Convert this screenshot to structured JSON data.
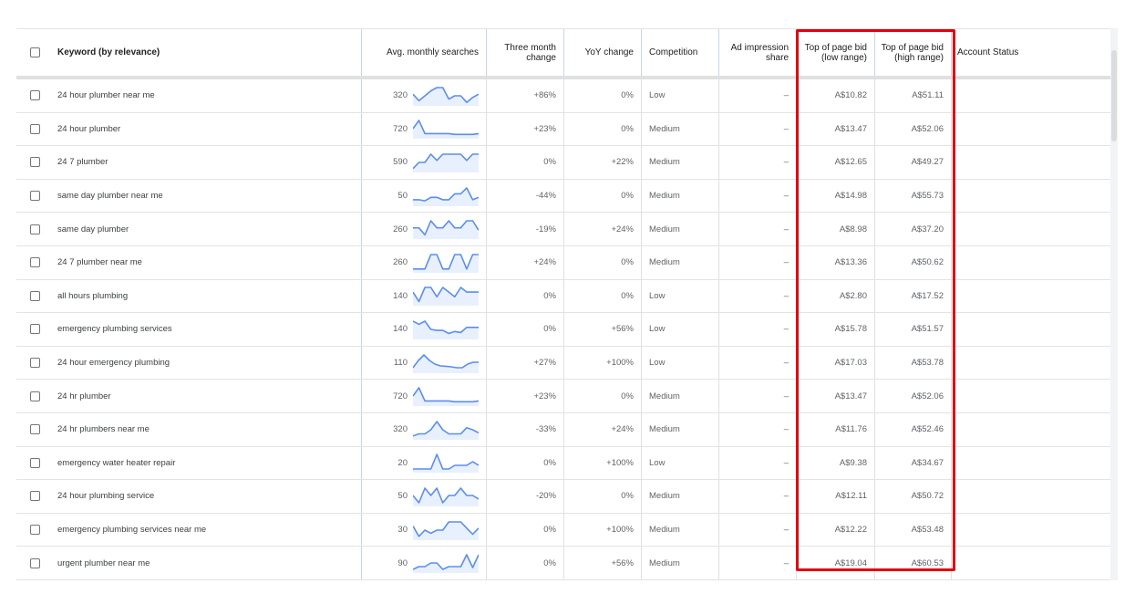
{
  "table": {
    "headers": {
      "keyword": "Keyword (by relevance)",
      "avg_searches": "Avg. monthly searches",
      "three_month": "Three month change",
      "yoy": "YoY change",
      "competition": "Competition",
      "ad_impression": "Ad impression share",
      "bid_low": "Top of page bid (low range)",
      "bid_high": "Top of page bid (high range)",
      "account_status": "Account Status"
    },
    "icons": {
      "select_all": "checkbox-icon",
      "row_select": "checkbox-icon",
      "trend": "sparkline-chart"
    },
    "colors": {
      "highlight_box": "#e3000f",
      "sparkline": "#5b8def",
      "sparkline_fill": "#e8f0fe"
    },
    "rows": [
      {
        "keyword": "24 hour plumber near me",
        "avg": "320",
        "trend": [
          6,
          2,
          5,
          8,
          10,
          10,
          3,
          5,
          5,
          1,
          4,
          6
        ],
        "three_month": "+86%",
        "yoy": "0%",
        "competition": "Low",
        "ad_share": "–",
        "bid_low": "A$10.82",
        "bid_high": "A$51.11"
      },
      {
        "keyword": "24 hour plumber",
        "avg": "720",
        "trend": [
          5,
          10,
          2,
          2,
          2,
          2,
          2,
          1.5,
          1.5,
          1.5,
          1.5,
          2
        ],
        "three_month": "+23%",
        "yoy": "0%",
        "competition": "Medium",
        "ad_share": "–",
        "bid_low": "A$13.47",
        "bid_high": "A$52.06"
      },
      {
        "keyword": "24 7 plumber",
        "avg": "590",
        "trend": [
          1,
          4,
          4,
          8,
          5,
          8,
          8,
          8,
          8,
          5,
          8,
          8
        ],
        "three_month": "0%",
        "yoy": "+22%",
        "competition": "Medium",
        "ad_share": "–",
        "bid_low": "A$12.65",
        "bid_high": "A$49.27"
      },
      {
        "keyword": "same day plumber near me",
        "avg": "50",
        "trend": [
          2,
          2,
          1.5,
          3,
          3,
          2,
          2,
          4.5,
          4.5,
          7,
          2,
          3
        ],
        "three_month": "-44%",
        "yoy": "0%",
        "competition": "Medium",
        "ad_share": "–",
        "bid_low": "A$14.98",
        "bid_high": "A$55.73"
      },
      {
        "keyword": "same day plumber",
        "avg": "260",
        "trend": [
          4,
          4,
          1,
          7,
          4,
          4,
          7,
          4,
          4,
          7,
          7,
          3
        ],
        "three_month": "-19%",
        "yoy": "+24%",
        "competition": "Medium",
        "ad_share": "–",
        "bid_low": "A$8.98",
        "bid_high": "A$37.20"
      },
      {
        "keyword": "24 7 plumber near me",
        "avg": "260",
        "trend": [
          1,
          1,
          1,
          8,
          8,
          1,
          1,
          8,
          8,
          1,
          8,
          8
        ],
        "three_month": "+24%",
        "yoy": "0%",
        "competition": "Medium",
        "ad_share": "–",
        "bid_low": "A$13.36",
        "bid_high": "A$50.62"
      },
      {
        "keyword": "all hours plumbing",
        "avg": "140",
        "trend": [
          5,
          1,
          7,
          7,
          3,
          7,
          5,
          3,
          7,
          5,
          5,
          5
        ],
        "three_month": "0%",
        "yoy": "0%",
        "competition": "Low",
        "ad_share": "–",
        "bid_low": "A$2.80",
        "bid_high": "A$17.52"
      },
      {
        "keyword": "emergency plumbing services",
        "avg": "140",
        "trend": [
          8,
          6.5,
          8,
          4,
          3.5,
          3.5,
          2,
          3,
          2.5,
          5,
          5,
          5
        ],
        "three_month": "0%",
        "yoy": "+56%",
        "competition": "Low",
        "ad_share": "–",
        "bid_low": "A$15.78",
        "bid_high": "A$51.57"
      },
      {
        "keyword": "24 hour emergency plumbing",
        "avg": "110",
        "trend": [
          2,
          6,
          9,
          6,
          4,
          3,
          2.8,
          2.5,
          2,
          2,
          4,
          5,
          5
        ],
        "three_month": "+27%",
        "yoy": "+100%",
        "competition": "Low",
        "ad_share": "–",
        "bid_low": "A$17.03",
        "bid_high": "A$53.78"
      },
      {
        "keyword": "24 hr plumber",
        "avg": "720",
        "trend": [
          5,
          10,
          2,
          2,
          2,
          2,
          2,
          1.5,
          1.5,
          1.5,
          1.5,
          2
        ],
        "three_month": "+23%",
        "yoy": "0%",
        "competition": "Medium",
        "ad_share": "–",
        "bid_low": "A$13.47",
        "bid_high": "A$52.06"
      },
      {
        "keyword": "24 hr plumbers near me",
        "avg": "320",
        "trend": [
          1,
          2,
          2,
          4,
          8,
          4,
          2,
          2,
          2,
          5,
          4,
          2.5
        ],
        "three_month": "-33%",
        "yoy": "+24%",
        "competition": "Medium",
        "ad_share": "–",
        "bid_low": "A$11.76",
        "bid_high": "A$52.46"
      },
      {
        "keyword": "emergency water heater repair",
        "avg": "20",
        "trend": [
          1,
          1,
          1,
          1,
          9,
          1,
          1,
          3,
          3,
          3,
          5,
          3
        ],
        "three_month": "0%",
        "yoy": "+100%",
        "competition": "Low",
        "ad_share": "–",
        "bid_low": "A$9.38",
        "bid_high": "A$34.67"
      },
      {
        "keyword": "24 hour plumbing service",
        "avg": "50",
        "trend": [
          5,
          1,
          9,
          5,
          9,
          1,
          5,
          5,
          9,
          5,
          5,
          3
        ],
        "three_month": "-20%",
        "yoy": "0%",
        "competition": "Medium",
        "ad_share": "–",
        "bid_low": "A$12.11",
        "bid_high": "A$50.72"
      },
      {
        "keyword": "emergency plumbing services near me",
        "avg": "30",
        "trend": [
          6,
          1,
          4,
          2.5,
          4,
          4,
          8,
          8,
          8,
          5,
          2,
          5
        ],
        "three_month": "0%",
        "yoy": "+100%",
        "competition": "Medium",
        "ad_share": "–",
        "bid_low": "A$12.22",
        "bid_high": "A$53.48"
      },
      {
        "keyword": "urgent plumber near me",
        "avg": "90",
        "trend": [
          1,
          2.5,
          2.5,
          4.5,
          4.5,
          1,
          2.5,
          2.5,
          2.5,
          9,
          2,
          9
        ],
        "three_month": "0%",
        "yoy": "+56%",
        "competition": "Medium",
        "ad_share": "–",
        "bid_low": "A$19.04",
        "bid_high": "A$60.53"
      }
    ]
  }
}
